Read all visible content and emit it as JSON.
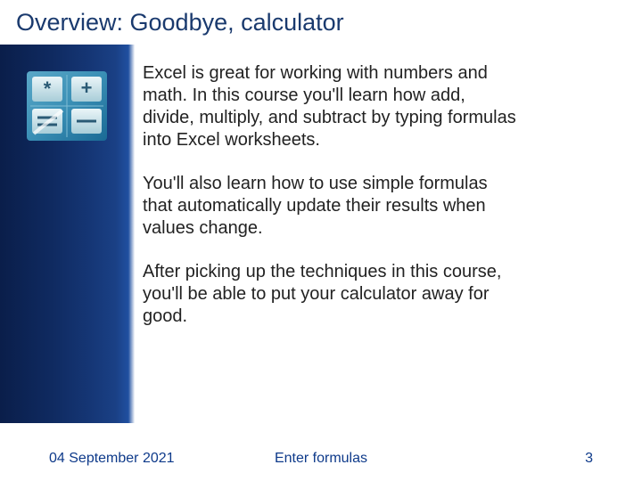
{
  "title": "Overview: Goodbye, calculator",
  "paragraphs": [
    "Excel is great for working with numbers and math. In this course you'll learn how add, divide, multiply, and subtract by typing formulas into Excel worksheets.",
    "You'll also learn how to use simple formulas that automatically update their results when values change.",
    "After picking up the techniques in this course, you'll be able to put your calculator away for good."
  ],
  "footer": {
    "date": "04 September 2021",
    "center": "Enter formulas",
    "page": "3"
  },
  "icon": "calculator-icon"
}
